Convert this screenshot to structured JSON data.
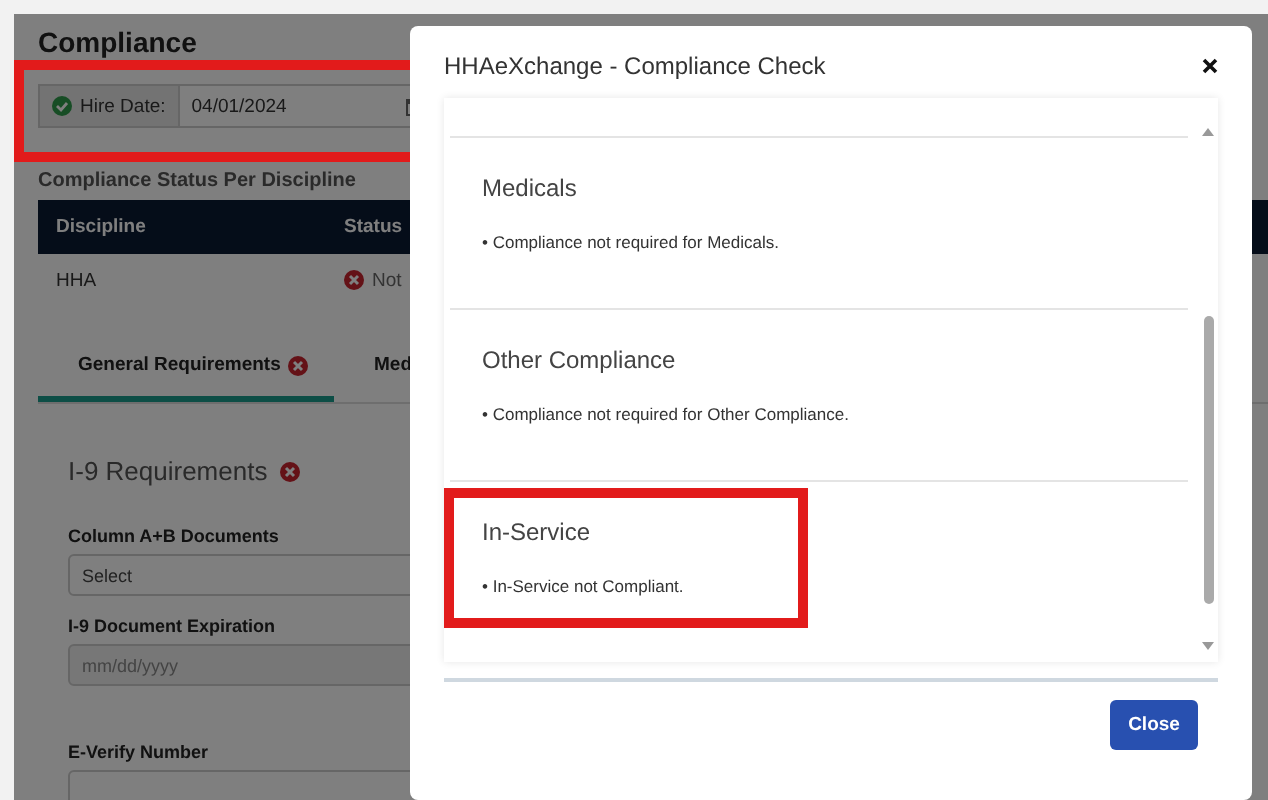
{
  "page": {
    "title": "Compliance",
    "hire_date": {
      "label": "Hire Date:",
      "value": "04/01/2024",
      "verified": true,
      "highlighted": true
    },
    "section_title": "Compliance Status Per Discipline",
    "table": {
      "columns": [
        "Discipline",
        "Status"
      ],
      "rows": [
        {
          "cells": [
            "HHA",
            "Not"
          ],
          "error": true
        }
      ]
    },
    "tabs": [
      {
        "label": "General Requirements",
        "selected": true,
        "error": true
      },
      {
        "label": "Med",
        "selected": false
      }
    ],
    "i9": {
      "title": "I-9 Requirements",
      "error": true,
      "fields": [
        {
          "kind": "select",
          "label": "Column A+B Documents",
          "value": "Select"
        },
        {
          "kind": "date",
          "label": "I-9 Document Expiration",
          "placeholder": "mm/dd/yyyy"
        },
        {
          "kind": "text",
          "label": "E-Verify Number"
        }
      ]
    }
  },
  "modal": {
    "title": "HHAeXchange - Compliance Check",
    "sections": [
      {
        "title": "Medicals",
        "items": [
          "• Compliance not required for Medicals."
        ],
        "highlighted": false
      },
      {
        "title": "Other Compliance",
        "items": [
          "• Compliance not required for Other Compliance."
        ],
        "highlighted": false
      },
      {
        "title": "In-Service",
        "items": [
          "• In-Service not Compliant."
        ],
        "highlighted": true
      }
    ],
    "close_label": "Close"
  }
}
